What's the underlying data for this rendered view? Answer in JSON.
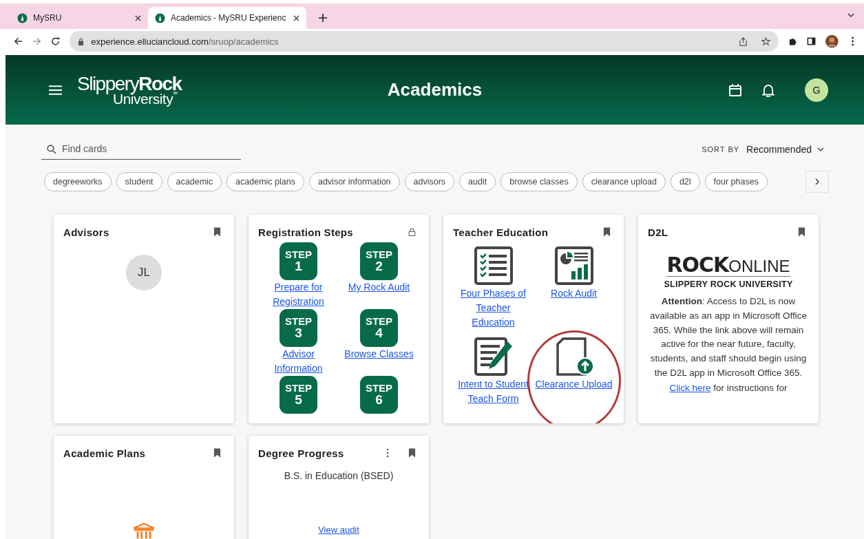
{
  "browser": {
    "tabs": [
      {
        "title": "MySRU",
        "selected": false
      },
      {
        "title": "Academics - MySRU Experienc",
        "selected": true
      }
    ],
    "url_host": "experience.elluciancloud.com",
    "url_path": "/sruop/academics"
  },
  "header": {
    "logo": {
      "light": "Slippery",
      "bold": "Rock",
      "second_line": "University",
      "mark": "SM"
    },
    "title": "Academics",
    "avatar": "G"
  },
  "search": {
    "placeholder": "Find cards"
  },
  "sort": {
    "label": "SORT BY",
    "value": "Recommended"
  },
  "chips": [
    "degreeworks",
    "student",
    "academic",
    "academic plans",
    "advisor information",
    "advisors",
    "audit",
    "browse classes",
    "clearance upload",
    "d2l",
    "four phases"
  ],
  "cards": [
    {
      "kind": "advisors",
      "title": "Advisors",
      "header_actions": [
        {
          "kind": "bookmark"
        }
      ],
      "initials": "JL"
    },
    {
      "kind": "steps",
      "title": "Registration Steps",
      "header_actions": [
        {
          "kind": "lock"
        }
      ],
      "steps": [
        {
          "word": "STEP",
          "number": "1",
          "label": "Prepare for Registration"
        },
        {
          "word": "STEP",
          "number": "2",
          "label": "My Rock Audit"
        },
        {
          "word": "STEP",
          "number": "3",
          "label": "Advisor Information"
        },
        {
          "word": "STEP",
          "number": "4",
          "label": "Browse Classes"
        },
        {
          "word": "STEP",
          "number": "5"
        },
        {
          "word": "STEP",
          "number": "6"
        }
      ]
    },
    {
      "kind": "links",
      "title": "Teacher Education",
      "header_actions": [
        {
          "kind": "bookmark"
        }
      ],
      "items": [
        {
          "kind": "checklist",
          "label": "Four Phases of Teacher Education",
          "highlighted": false
        },
        {
          "kind": "report",
          "label": "Rock Audit",
          "highlighted": false
        },
        {
          "kind": "form",
          "label": "Intent to Student Teach Form",
          "highlighted": false
        },
        {
          "kind": "upload",
          "label": "Clearance Upload",
          "highlighted": true
        }
      ]
    },
    {
      "kind": "d2l",
      "title": "D2L",
      "header_actions": [
        {
          "kind": "bookmark"
        }
      ],
      "brand": {
        "bold": "ROCK",
        "light": "ONLINE",
        "subtitle": "SLIPPERY ROCK UNIVERSITY"
      },
      "text_before": "**Attention**: Access to D2L is now available as an app in Microsoft Office 365. While the link above will remain active for the near future, faculty, students, and staff should begin using the D2L app in Microsoft Office 365.",
      "link": "Click here",
      "text_after": "for instructions for"
    },
    {
      "kind": "plans",
      "title": "Academic Plans",
      "header_actions": [
        {
          "kind": "bookmark"
        }
      ]
    },
    {
      "kind": "progress",
      "title": "Degree Progress",
      "header_actions": [
        {
          "kind": "menu"
        },
        {
          "kind": "bookmark"
        }
      ],
      "program": "B.S. in Education (BSED)",
      "link": "View audit"
    }
  ]
}
